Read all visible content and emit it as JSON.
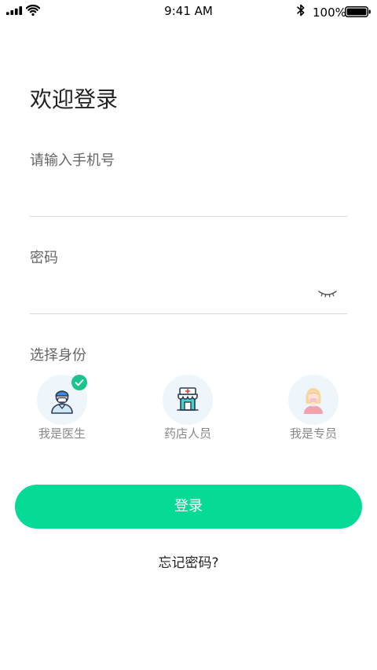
{
  "status_bar": {
    "time": "9:41 AM",
    "battery_text": "100%",
    "icons": [
      "cellular-signal-icon",
      "wifi-icon",
      "bluetooth-icon",
      "battery-icon"
    ]
  },
  "login": {
    "title": "欢迎登录",
    "phone_label": "请输入手机号",
    "password_label": "密码",
    "password_toggle_icon": "eye-closed-icon",
    "role_section_label": "选择身份",
    "roles": [
      {
        "label": "我是医生",
        "icon": "doctor-icon",
        "selected": true
      },
      {
        "label": "药店人员",
        "icon": "pharmacy-icon",
        "selected": false
      },
      {
        "label": "我是专员",
        "icon": "staff-icon",
        "selected": false
      }
    ],
    "submit_label": "登录",
    "forgot_password_label": "忘记密码?"
  },
  "colors": {
    "accent": "#05DB96",
    "selected_badge": "#1BC48F",
    "role_circle_bg": "#EEF6FC",
    "title_text": "#222222",
    "label_text": "#666666",
    "divider": "#D9D9D9"
  }
}
